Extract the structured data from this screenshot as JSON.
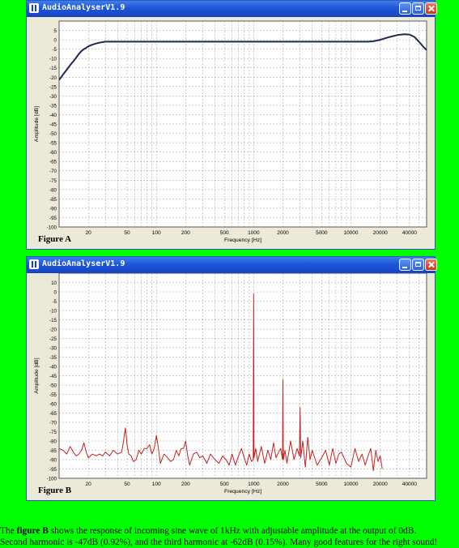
{
  "colors": {
    "page_background": "#00ff00",
    "curve_a": "#1f2a55",
    "curve_b": "#c62020",
    "titlebar": "#1d56d9"
  },
  "window_a": {
    "title": "AudioAnalyserV1.9",
    "figure_label": "Figure A",
    "chart_data": {
      "type": "line",
      "xlabel": "Frequency [Hz]",
      "ylabel": "Amplitude [dB]",
      "x_scale": "log",
      "xlim": [
        10,
        60000
      ],
      "ylim": [
        -100,
        10
      ],
      "grid": true,
      "x_tick_labels": [
        "20",
        "50",
        "100",
        "200",
        "500",
        "1000",
        "2000",
        "5000",
        "10000",
        "20000",
        "40000"
      ],
      "y_tick_labels": [
        "5",
        "0",
        "-5",
        "-10",
        "-15",
        "-20",
        "-25",
        "-30",
        "-35",
        "-40",
        "-45",
        "-50",
        "-55",
        "-60",
        "-65",
        "-70",
        "-75",
        "-80",
        "-85",
        "-90",
        "-95",
        "-100"
      ],
      "series": [
        {
          "x": [
            10,
            11,
            12,
            13,
            14,
            15,
            16,
            17,
            18,
            20,
            22,
            24,
            26,
            30,
            40,
            100,
            1000,
            10000,
            15000,
            17000,
            20000,
            25000,
            30000,
            35000,
            40000,
            45000,
            50000,
            55000,
            60000
          ],
          "y": [
            -21.5,
            -18.5,
            -16,
            -13.5,
            -11.5,
            -9.5,
            -7.5,
            -6,
            -5,
            -3.5,
            -2.6,
            -2,
            -1.5,
            -1,
            -1,
            -1,
            -1,
            -1,
            -1,
            -0.8,
            0,
            1.5,
            2.5,
            3,
            2.8,
            1.5,
            -1,
            -3.5,
            -5.5
          ]
        }
      ]
    }
  },
  "window_b": {
    "title": "AudioAnalyserV1.9",
    "figure_label": "Figure B",
    "chart_data": {
      "type": "line",
      "xlabel": "Frequency [Hz]",
      "ylabel": "Amplitude [dB]",
      "x_scale": "log",
      "xlim": [
        10,
        60000
      ],
      "ylim": [
        -100,
        10
      ],
      "grid": true,
      "x_tick_labels": [
        "20",
        "50",
        "100",
        "200",
        "500",
        "1000",
        "2000",
        "5000",
        "10000",
        "20000",
        "40000"
      ],
      "y_tick_labels": [
        "10",
        "0",
        "-5",
        "-10",
        "-15",
        "-20",
        "-25",
        "-30",
        "-35",
        "-40",
        "-45",
        "-50",
        "-55",
        "-60",
        "-65",
        "-70",
        "-75",
        "-80",
        "-85",
        "-90",
        "-95",
        "-100"
      ],
      "series": [
        {
          "x": [
            10,
            11,
            12,
            13,
            14,
            15,
            16,
            17,
            18,
            19,
            20,
            22,
            24,
            26,
            28,
            30,
            33,
            36,
            40,
            44,
            46,
            48,
            50,
            52,
            55,
            58,
            62,
            66,
            70,
            75,
            80,
            85,
            90,
            95,
            100,
            105,
            110,
            120,
            130,
            140,
            150,
            160,
            170,
            180,
            190,
            200,
            210,
            220,
            240,
            260,
            280,
            300,
            330,
            360,
            400,
            440,
            480,
            520,
            560,
            600,
            650,
            700,
            750,
            800,
            850,
            900,
            950,
            990,
            1000,
            1010,
            1050,
            1100,
            1200,
            1300,
            1400,
            1500,
            1600,
            1700,
            1800,
            1900,
            1980,
            2000,
            2020,
            2100,
            2200,
            2400,
            2600,
            2800,
            2950,
            3000,
            3050,
            3200,
            3400,
            3600,
            3800,
            4000,
            4500,
            5000,
            5500,
            6000,
            6500,
            7000,
            7500,
            8000,
            9000,
            10000,
            11000,
            12000,
            13000,
            14000,
            15000,
            16000,
            17000,
            18000,
            19000,
            20000,
            21000
          ],
          "y": [
            -84,
            -85,
            -87,
            -83,
            -86,
            -88,
            -87,
            -85,
            -81,
            -86,
            -89,
            -87,
            -88,
            -87,
            -88,
            -86,
            -88,
            -85,
            -87,
            -86,
            -80,
            -73,
            -82,
            -87,
            -88,
            -91,
            -90,
            -85,
            -87,
            -84,
            -84,
            -82,
            -87,
            -84,
            -77,
            -84,
            -92,
            -87,
            -89,
            -91,
            -90,
            -85,
            -88,
            -84,
            -84,
            -80,
            -88,
            -93,
            -87,
            -86,
            -89,
            -88,
            -92,
            -87,
            -90,
            -92,
            -88,
            -90,
            -93,
            -87,
            -93,
            -88,
            -84,
            -89,
            -93,
            -87,
            -91,
            -90,
            -1,
            -89,
            -84,
            -91,
            -83,
            -92,
            -85,
            -90,
            -81,
            -89,
            -86,
            -84,
            -90,
            -47,
            -90,
            -85,
            -92,
            -80,
            -90,
            -84,
            -88,
            -62,
            -89,
            -80,
            -94,
            -78,
            -90,
            -85,
            -93,
            -89,
            -85,
            -93,
            -84,
            -92,
            -87,
            -86,
            -92,
            -94,
            -84,
            -91,
            -87,
            -93,
            -88,
            -84,
            -96,
            -85,
            -91,
            -88,
            -95
          ]
        }
      ]
    }
  },
  "caption": {
    "pre1": "The ",
    "bold1": "figure B",
    "post1": " shows the response of incoming sine wave of 1kHz with adjustable amplitude at the output of 0dB.",
    "line2": "Second harmonic is -47dB (0.92%), and the third harmonic at -62dB (0.15%). Many good features for the right sound!"
  }
}
